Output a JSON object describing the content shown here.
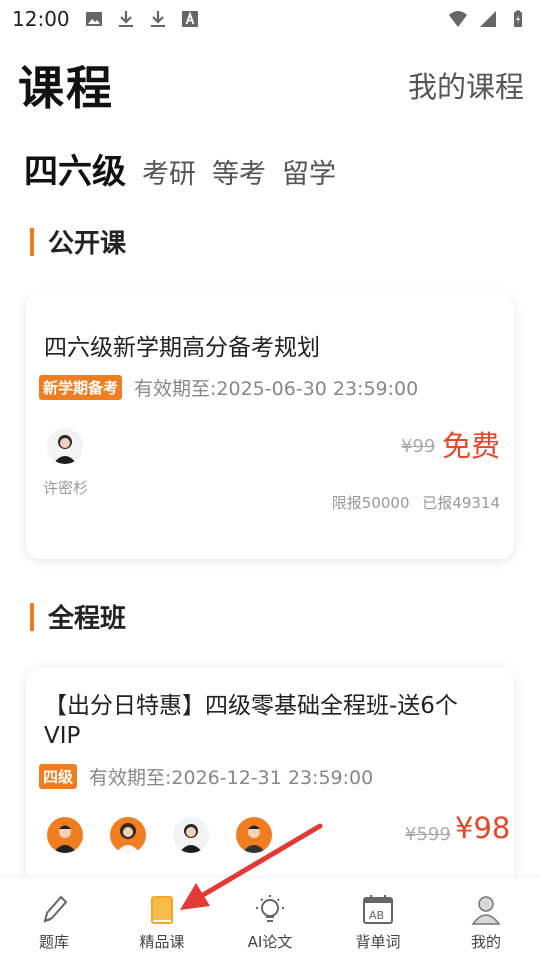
{
  "status_bar": {
    "time": "12:00"
  },
  "header": {
    "title": "课程",
    "my_courses": "我的课程"
  },
  "tabs": [
    {
      "label": "四六级",
      "active": true
    },
    {
      "label": "考研",
      "active": false
    },
    {
      "label": "等考",
      "active": false
    },
    {
      "label": "留学",
      "active": false
    }
  ],
  "sections": {
    "open": "公开课",
    "full": "全程班"
  },
  "course_open": {
    "title": "四六级新学期高分备考规划",
    "tag": "新学期备考",
    "validity": "有效期至:2025-06-30 23:59:00",
    "teacher": "许密杉",
    "orig_price": "¥99",
    "price": "免费",
    "limit": "限报50000",
    "enrolled": "已报49314"
  },
  "course_full": {
    "title_line1": "【出分日特惠】四级零基础全程班-送6个",
    "title_line2": "VIP",
    "tag": "四级",
    "validity": "有效期至:2026-12-31 23:59:00",
    "orig_price": "¥599",
    "price": "¥98"
  },
  "bottom_nav": [
    {
      "label": "题库",
      "icon": "pencil-icon"
    },
    {
      "label": "精品课",
      "icon": "book-icon",
      "active": true
    },
    {
      "label": "AI论文",
      "icon": "lightbulb-icon"
    },
    {
      "label": "背单词",
      "icon": "calendar-icon"
    },
    {
      "label": "我的",
      "icon": "user-icon"
    }
  ],
  "colors": {
    "accent": "#f07d1f",
    "price": "#e8472a",
    "arrow": "#e53935"
  }
}
